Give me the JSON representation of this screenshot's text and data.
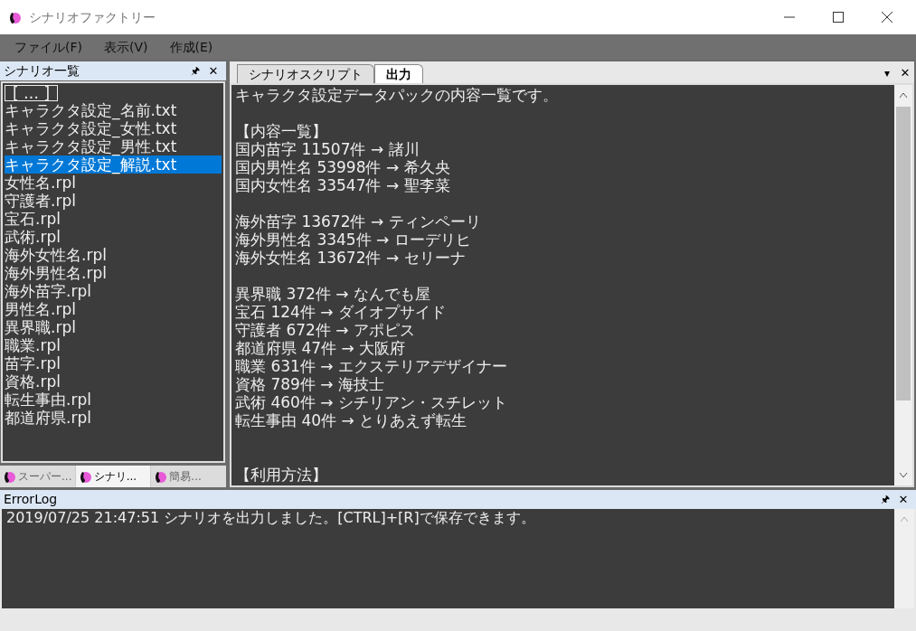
{
  "window": {
    "title": "シナリオファクトリー"
  },
  "menu": [
    "ファイル(F)",
    "表示(V)",
    "作成(E)"
  ],
  "scenario_list": {
    "title": "シナリオ一覧",
    "pin": "🖈",
    "close": "✕",
    "items": [
      {
        "label": "[ … ]",
        "kind": "parent",
        "selected": false
      },
      {
        "label": "キャラクタ設定_名前.txt",
        "kind": "file",
        "selected": false
      },
      {
        "label": "キャラクタ設定_女性.txt",
        "kind": "file",
        "selected": false
      },
      {
        "label": "キャラクタ設定_男性.txt",
        "kind": "file",
        "selected": false
      },
      {
        "label": "キャラクタ設定_解説.txt",
        "kind": "file",
        "selected": true
      },
      {
        "label": "女性名.rpl",
        "kind": "file",
        "selected": false
      },
      {
        "label": "守護者.rpl",
        "kind": "file",
        "selected": false
      },
      {
        "label": "宝石.rpl",
        "kind": "file",
        "selected": false
      },
      {
        "label": "武術.rpl",
        "kind": "file",
        "selected": false
      },
      {
        "label": "海外女性名.rpl",
        "kind": "file",
        "selected": false
      },
      {
        "label": "海外男性名.rpl",
        "kind": "file",
        "selected": false
      },
      {
        "label": "海外苗字.rpl",
        "kind": "file",
        "selected": false
      },
      {
        "label": "男性名.rpl",
        "kind": "file",
        "selected": false
      },
      {
        "label": "異界職.rpl",
        "kind": "file",
        "selected": false
      },
      {
        "label": "職業.rpl",
        "kind": "file",
        "selected": false
      },
      {
        "label": "苗字.rpl",
        "kind": "file",
        "selected": false
      },
      {
        "label": "資格.rpl",
        "kind": "file",
        "selected": false
      },
      {
        "label": "転生事由.rpl",
        "kind": "file",
        "selected": false
      },
      {
        "label": "都道府県.rpl",
        "kind": "file",
        "selected": false
      }
    ],
    "bottom_tabs": [
      {
        "label": "スーパー...",
        "selected": false
      },
      {
        "label": "シナリ...",
        "selected": true
      },
      {
        "label": "簡易...",
        "selected": false
      }
    ]
  },
  "editor": {
    "tabs": [
      {
        "label": "シナリオスクリプト",
        "selected": false
      },
      {
        "label": "出力",
        "selected": true
      }
    ],
    "dropdown": "▾",
    "close": "✕",
    "blocks": [
      {
        "kind": "near",
        "lines": [
          "キャラクタ設定データパックの内容一覧です。"
        ]
      },
      {
        "kind": "near",
        "lines": [
          "【内容一覧】",
          "国内苗字 11507件 → 諸川",
          "国内男性名 53998件 → 希久央",
          "国内女性名 33547件 → 聖李菜"
        ]
      },
      {
        "kind": "near",
        "lines": [
          "海外苗字 13672件 → ティンペーリ",
          "海外男性名 3345件 → ローデリヒ",
          "海外女性名 13672件 → セリーナ"
        ]
      },
      {
        "kind": "near",
        "lines": [
          "異界職 372件 → なんでも屋",
          "宝石 124件 → ダイオプサイド",
          "守護者 672件 → アポピス",
          "都道府県 47件 → 大阪府",
          "職業 631件 → エクステリアデザイナー",
          "資格 789件 → 海技士",
          "武術 460件 → シチリアン・スチレット",
          "転生事由 40件 → とりあえず転生"
        ]
      },
      {
        "kind": "far",
        "lines": [
          "【利用方法】"
        ]
      }
    ]
  },
  "error_log": {
    "title": "ErrorLog",
    "pin": "🖈",
    "close": "✕",
    "lines": [
      "2019/07/25 21:47:51 シナリオを出力しました。[CTRL]+[R]で保存できます。"
    ]
  }
}
